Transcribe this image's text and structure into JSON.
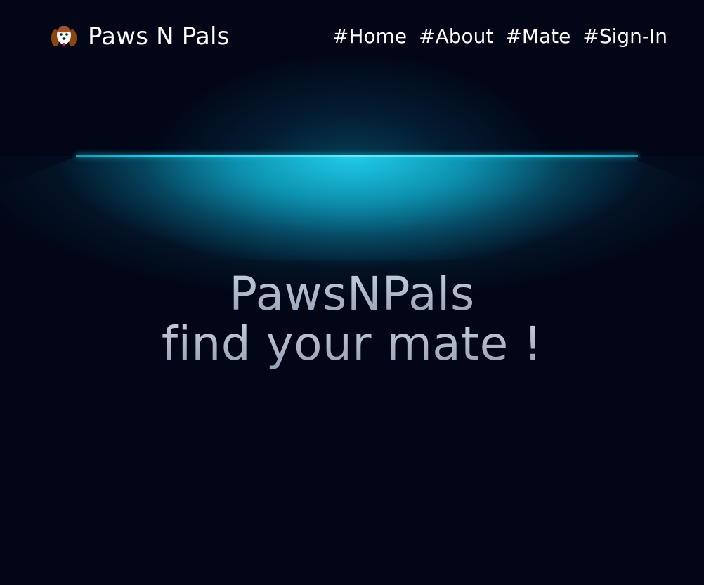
{
  "brand": {
    "name": "Paws N Pals",
    "icon": "dog-face-icon"
  },
  "nav": {
    "items": [
      {
        "label": "#Home"
      },
      {
        "label": "#About"
      },
      {
        "label": "#Mate"
      },
      {
        "label": "#Sign-In"
      }
    ]
  },
  "hero": {
    "title": "PawsNPals",
    "subtitle": "find your mate !"
  },
  "colors": {
    "background": "#020617",
    "lamp": "#22d3ee",
    "hero_text": "#a3adc2"
  }
}
